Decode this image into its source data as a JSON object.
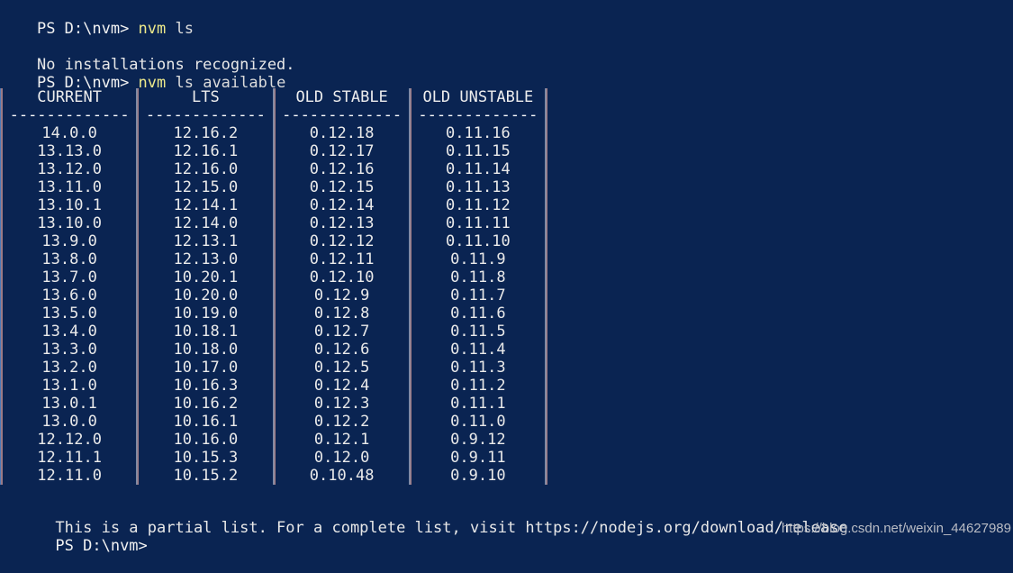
{
  "terminal": {
    "background_color": "#0a2452",
    "text_color": "#e8e8e8",
    "accent_command_color": "#ede98a",
    "separator_color": "#8a8a9a",
    "lines": {
      "prompt1": "PS D:\\nvm> ",
      "cmd1": "nvm",
      "cmd1_args": " ls",
      "blank1": "",
      "message": "No installations recognized.",
      "prompt2": "PS D:\\nvm> ",
      "cmd2": "nvm",
      "cmd2_args": " ls available",
      "footer_note": "This is a partial list. For a complete list, visit https://nodejs.org/download/release",
      "prompt3": "PS D:\\nvm>"
    }
  },
  "table": {
    "headers": [
      "CURRENT",
      "LTS",
      "OLD STABLE",
      "OLD UNSTABLE"
    ],
    "separator_dashes": "-------------",
    "columns": {
      "current": [
        "14.0.0",
        "13.13.0",
        "13.12.0",
        "13.11.0",
        "13.10.1",
        "13.10.0",
        "13.9.0",
        "13.8.0",
        "13.7.0",
        "13.6.0",
        "13.5.0",
        "13.4.0",
        "13.3.0",
        "13.2.0",
        "13.1.0",
        "13.0.1",
        "13.0.0",
        "12.12.0",
        "12.11.1",
        "12.11.0"
      ],
      "lts": [
        "12.16.2",
        "12.16.1",
        "12.16.0",
        "12.15.0",
        "12.14.1",
        "12.14.0",
        "12.13.1",
        "12.13.0",
        "10.20.1",
        "10.20.0",
        "10.19.0",
        "10.18.1",
        "10.18.0",
        "10.17.0",
        "10.16.3",
        "10.16.2",
        "10.16.1",
        "10.16.0",
        "10.15.3",
        "10.15.2"
      ],
      "old_stable": [
        "0.12.18",
        "0.12.17",
        "0.12.16",
        "0.12.15",
        "0.12.14",
        "0.12.13",
        "0.12.12",
        "0.12.11",
        "0.12.10",
        "0.12.9",
        "0.12.8",
        "0.12.7",
        "0.12.6",
        "0.12.5",
        "0.12.4",
        "0.12.3",
        "0.12.2",
        "0.12.1",
        "0.12.0",
        "0.10.48"
      ],
      "old_unstable": [
        "0.11.16",
        "0.11.15",
        "0.11.14",
        "0.11.13",
        "0.11.12",
        "0.11.11",
        "0.11.10",
        "0.11.9",
        "0.11.8",
        "0.11.7",
        "0.11.6",
        "0.11.5",
        "0.11.4",
        "0.11.3",
        "0.11.2",
        "0.11.1",
        "0.11.0",
        "0.9.12",
        "0.9.11",
        "0.9.10"
      ]
    }
  },
  "watermark": {
    "text": "https://blog.csdn.net/weixin_44627989"
  }
}
